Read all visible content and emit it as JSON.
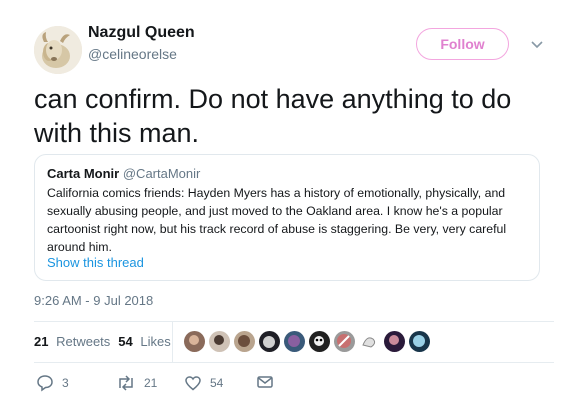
{
  "user": {
    "name": "Nazgul Queen",
    "handle": "@celineorelse",
    "avatar_icon": "goat-avatar-icon"
  },
  "follow_label": "Follow",
  "tweet_text": "can confirm. Do not have anything to do with this man.",
  "quoted": {
    "name": "Carta Monir",
    "handle": "@CartaMonir",
    "text": "California comics friends: Hayden Myers has a history of emotionally, physically, and sexually abusing people, and just moved to the Oakland area. I know he's a popular cartoonist right now, but his track record of abuse is staggering. Be very, very careful around him.",
    "show_thread": "Show this thread"
  },
  "timestamp": "9:26 AM - 9 Jul 2018",
  "stats": {
    "retweets_count": "21",
    "retweets_label": "Retweets",
    "likes_count": "54",
    "likes_label": "Likes"
  },
  "actions": {
    "reply_count": "3",
    "retweet_count": "21",
    "like_count": "54"
  },
  "colors": {
    "accent_pink": "#e081cf",
    "link_blue": "#1b95e0",
    "muted": "#657786"
  }
}
